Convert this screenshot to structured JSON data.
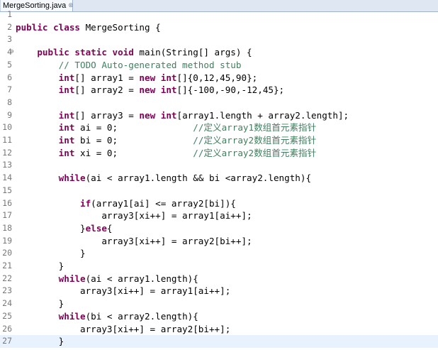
{
  "tab": {
    "label": "MergeSorting.java",
    "close_glyph": "⊗"
  },
  "editor": {
    "current_line": 27,
    "lines": [
      {
        "n": "1",
        "segs": []
      },
      {
        "n": "2",
        "segs": [
          {
            "t": "kw",
            "v": "public class"
          },
          {
            "t": "p",
            "v": " MergeSorting {"
          }
        ]
      },
      {
        "n": "3",
        "segs": []
      },
      {
        "n": "4",
        "fold": "⊖",
        "segs": [
          {
            "t": "p",
            "v": "    "
          },
          {
            "t": "kw",
            "v": "public static void"
          },
          {
            "t": "p",
            "v": " main(String[] args) {"
          }
        ]
      },
      {
        "n": "5",
        "segs": [
          {
            "t": "p",
            "v": "        "
          },
          {
            "t": "cm",
            "v": "// TODO Auto-generated method stub"
          }
        ]
      },
      {
        "n": "6",
        "segs": [
          {
            "t": "p",
            "v": "        "
          },
          {
            "t": "kw",
            "v": "int"
          },
          {
            "t": "p",
            "v": "[] array1 = "
          },
          {
            "t": "kw",
            "v": "new int"
          },
          {
            "t": "p",
            "v": "[]{0,12,45,90};"
          }
        ]
      },
      {
        "n": "7",
        "segs": [
          {
            "t": "p",
            "v": "        "
          },
          {
            "t": "kw",
            "v": "int"
          },
          {
            "t": "p",
            "v": "[] array2 = "
          },
          {
            "t": "kw",
            "v": "new int"
          },
          {
            "t": "p",
            "v": "[]{-100,-90,-12,45};"
          }
        ]
      },
      {
        "n": "8",
        "segs": []
      },
      {
        "n": "9",
        "segs": [
          {
            "t": "p",
            "v": "        "
          },
          {
            "t": "kw",
            "v": "int"
          },
          {
            "t": "p",
            "v": "[] array3 = "
          },
          {
            "t": "kw",
            "v": "new int"
          },
          {
            "t": "p",
            "v": "[array1.length + array2.length];"
          }
        ]
      },
      {
        "n": "10",
        "segs": [
          {
            "t": "p",
            "v": "        "
          },
          {
            "t": "kw",
            "v": "int"
          },
          {
            "t": "p",
            "v": " ai = 0;              "
          },
          {
            "t": "cm",
            "v": "//定义array1数组首元素指针"
          }
        ]
      },
      {
        "n": "11",
        "segs": [
          {
            "t": "p",
            "v": "        "
          },
          {
            "t": "kw",
            "v": "int"
          },
          {
            "t": "p",
            "v": " bi = 0;              "
          },
          {
            "t": "cm",
            "v": "//定义array2数组首元素指针"
          }
        ]
      },
      {
        "n": "12",
        "segs": [
          {
            "t": "p",
            "v": "        "
          },
          {
            "t": "kw",
            "v": "int"
          },
          {
            "t": "p",
            "v": " xi = 0;              "
          },
          {
            "t": "cm",
            "v": "//定义array2数组首元素指针"
          }
        ]
      },
      {
        "n": "13",
        "segs": []
      },
      {
        "n": "14",
        "segs": [
          {
            "t": "p",
            "v": "        "
          },
          {
            "t": "kw",
            "v": "while"
          },
          {
            "t": "p",
            "v": "(ai < array1.length && bi <array2.length){"
          }
        ]
      },
      {
        "n": "15",
        "segs": []
      },
      {
        "n": "16",
        "segs": [
          {
            "t": "p",
            "v": "            "
          },
          {
            "t": "kw",
            "v": "if"
          },
          {
            "t": "p",
            "v": "(array1[ai] <= array2[bi]){"
          }
        ]
      },
      {
        "n": "17",
        "segs": [
          {
            "t": "p",
            "v": "                array3[xi++] = array1[ai++];"
          }
        ]
      },
      {
        "n": "18",
        "segs": [
          {
            "t": "p",
            "v": "            }"
          },
          {
            "t": "kw",
            "v": "else"
          },
          {
            "t": "p",
            "v": "{"
          }
        ]
      },
      {
        "n": "19",
        "segs": [
          {
            "t": "p",
            "v": "                array3[xi++] = array2[bi++];"
          }
        ]
      },
      {
        "n": "20",
        "segs": [
          {
            "t": "p",
            "v": "            }"
          }
        ]
      },
      {
        "n": "21",
        "segs": [
          {
            "t": "p",
            "v": "        }"
          }
        ]
      },
      {
        "n": "22",
        "segs": [
          {
            "t": "p",
            "v": "        "
          },
          {
            "t": "kw",
            "v": "while"
          },
          {
            "t": "p",
            "v": "(ai < array1.length){"
          }
        ]
      },
      {
        "n": "23",
        "segs": [
          {
            "t": "p",
            "v": "            array3[xi++] = array1[ai++];"
          }
        ]
      },
      {
        "n": "24",
        "segs": [
          {
            "t": "p",
            "v": "        }"
          }
        ]
      },
      {
        "n": "25",
        "segs": [
          {
            "t": "p",
            "v": "        "
          },
          {
            "t": "kw",
            "v": "while"
          },
          {
            "t": "p",
            "v": "(bi < array2.length){"
          }
        ]
      },
      {
        "n": "26",
        "segs": [
          {
            "t": "p",
            "v": "            array3[xi++] = array2[bi++];"
          }
        ]
      },
      {
        "n": "27",
        "segs": [
          {
            "t": "p",
            "v": "        }"
          }
        ]
      }
    ]
  }
}
